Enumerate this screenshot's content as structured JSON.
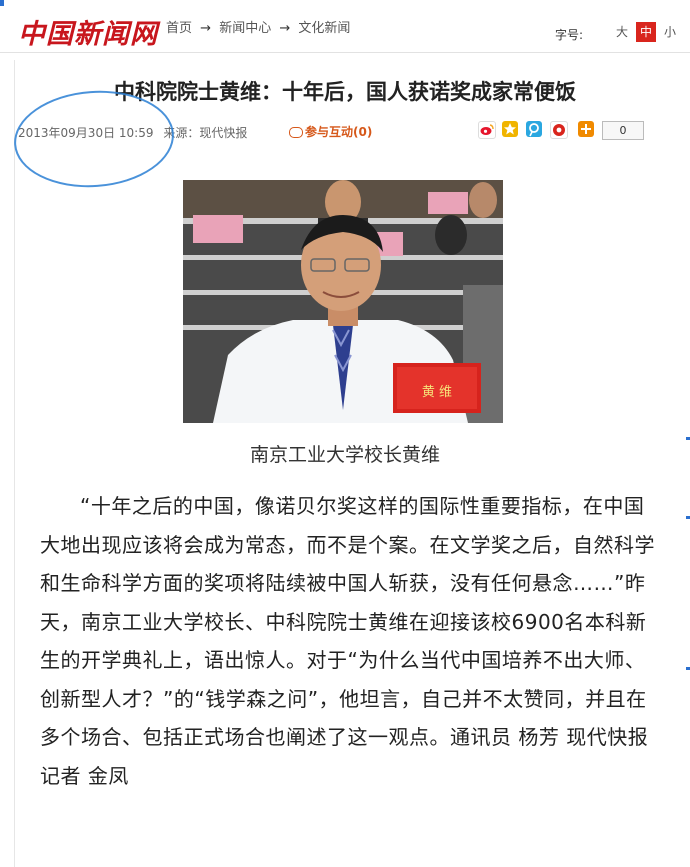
{
  "header": {
    "logo": "中国新闻网",
    "breadcrumb": [
      "首页",
      "新闻中心",
      "文化新闻"
    ],
    "breadcrumb_separator": "→",
    "font_size_label": "字号:",
    "font_size_options": [
      "大",
      "中",
      "小"
    ],
    "font_size_selected": "中"
  },
  "article": {
    "title": "中科院院士黄维：十年后，国人获诺奖成家常便饭",
    "datetime": "2013年09月30日 10:59",
    "source": "来源：现代快报",
    "interact_label": "参与互动(0)",
    "share_count": "0",
    "photo_nameplate": "黄 维",
    "photo_caption": "南京工业大学校长黄维",
    "body": "“十年之后的中国，像诺贝尔奖这样的国际性重要指标，在中国大地出现应该将会成为常态，而不是个案。在文学奖之后，自然科学和生命科学方面的奖项将陆续被中国人斩获，没有任何悬念……”昨天，南京工业大学校长、中科院院士黄维在迎接该校6900名本科新生的开学典礼上，语出惊人。对于“为什么当代中国培养不出大师、创新型人才？”的“钱学森之问”，他坦言，自己并不太赞同，并且在多个场合、包括正式场合也阐述了这一观点。通讯员 杨芳 现代快报记者 金凤"
  },
  "share_icons": [
    "weibo-icon",
    "qzone-icon",
    "tencent-weibo-icon",
    "renren-icon",
    "more-share-icon"
  ],
  "colors": {
    "brand_red": "#c8161d",
    "accent_red": "#d9251d",
    "interact_orange": "#d6581a",
    "annotation_blue": "#2a7fd4"
  }
}
